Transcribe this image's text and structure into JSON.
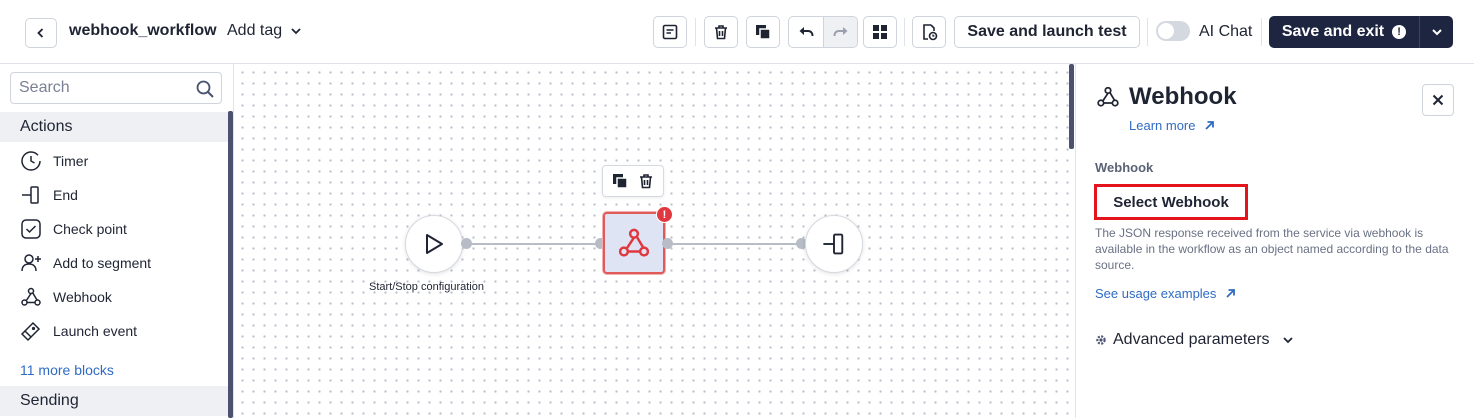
{
  "header": {
    "workflow_name": "webhook_workflow",
    "add_tag_label": "Add tag",
    "launch_test_label": "Save and launch test",
    "ai_chat_label": "AI Chat",
    "ai_chat_enabled": false,
    "save_exit_label": "Save and exit",
    "save_exit_warning": "!"
  },
  "sidebar": {
    "search_placeholder": "Search",
    "sections": [
      {
        "label": "Actions"
      },
      {
        "label": "Sending"
      }
    ],
    "items": [
      {
        "label": "Timer",
        "icon": "timer-icon"
      },
      {
        "label": "End",
        "icon": "end-icon"
      },
      {
        "label": "Check point",
        "icon": "check-point-icon"
      },
      {
        "label": "Add to segment",
        "icon": "add-to-segment-icon"
      },
      {
        "label": "Webhook",
        "icon": "webhook-icon"
      },
      {
        "label": "Launch event",
        "icon": "launch-event-icon"
      }
    ],
    "more_blocks_label": "11 more blocks"
  },
  "canvas": {
    "start_label": "Start/Stop configuration",
    "webhook_error_badge": "!"
  },
  "panel": {
    "title": "Webhook",
    "learn_more_label": "Learn more",
    "field_label": "Webhook",
    "select_label": "Select Webhook",
    "help_text": "The JSON response received from the service via webhook is available in the workflow as an object named according to the data source.",
    "usage_link_label": "See usage examples",
    "advanced_label": "Advanced parameters"
  },
  "colors": {
    "primary_dark": "#1e2541",
    "link": "#2f6bc4",
    "error": "#e0383e",
    "highlight_border": "#e3141b"
  }
}
